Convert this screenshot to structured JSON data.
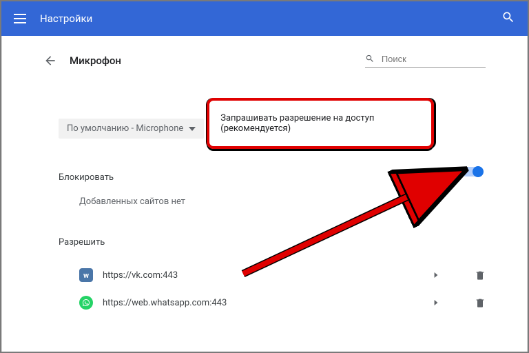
{
  "header": {
    "title": "Настройки"
  },
  "page": {
    "title": "Микрофон"
  },
  "search": {
    "placeholder": "Поиск"
  },
  "dropdown": {
    "label": "По умолчанию - Microphone"
  },
  "permission": {
    "label": "Запрашивать разрешение на доступ (рекомендуется)"
  },
  "block": {
    "label": "Блокировать",
    "empty": "Добавленных сайтов нет"
  },
  "allow": {
    "label": "Разрешить",
    "sites": [
      {
        "url": "https://vk.com:443"
      },
      {
        "url": "https://web.whatsapp.com:443"
      }
    ]
  }
}
